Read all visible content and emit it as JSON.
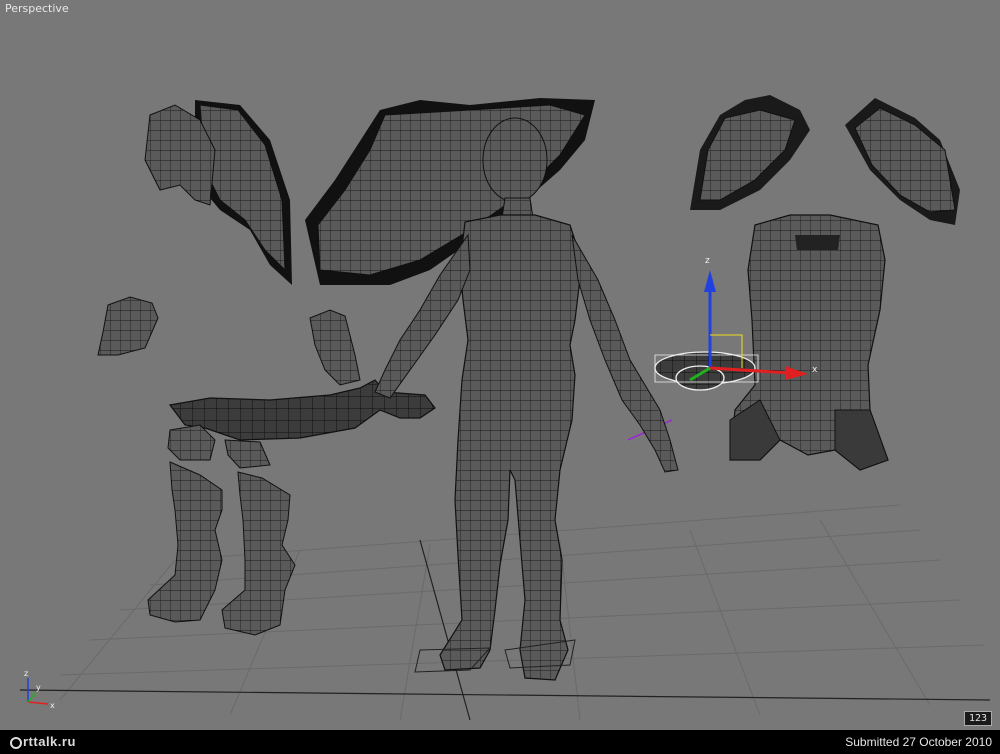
{
  "viewport": {
    "label": "Perspective",
    "badge": "123",
    "gizmo_axes": {
      "x": "x",
      "y": "y",
      "z": "z"
    },
    "axis_colors": {
      "x": "#e02020",
      "y": "#20b020",
      "z": "#2040e0"
    }
  },
  "footer": {
    "logo_text": "rttalk.ru",
    "submitted": "Submitted 27 October 2010"
  }
}
